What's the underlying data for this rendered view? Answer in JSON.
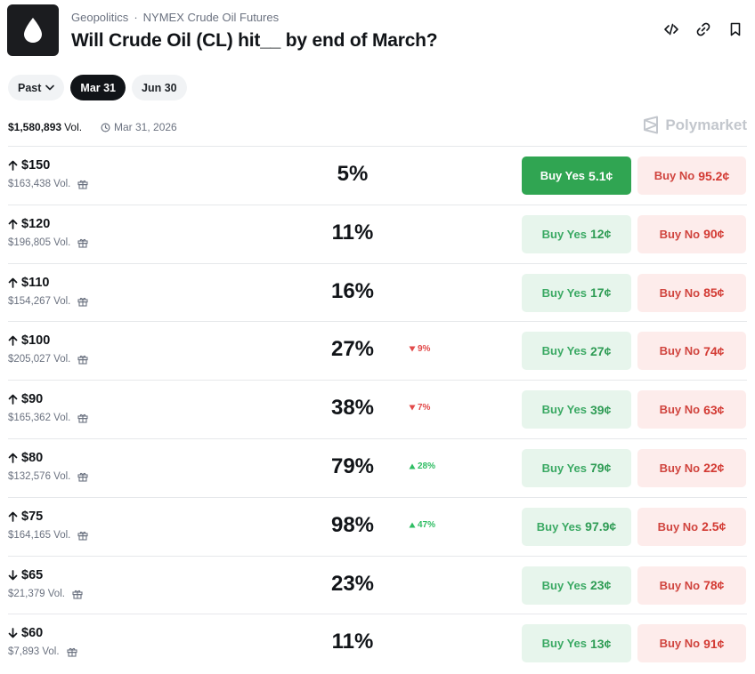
{
  "header": {
    "category": "Geopolitics",
    "separator": "·",
    "subcategory": "NYMEX Crude Oil Futures",
    "title": "Will Crude Oil (CL) hit__ by end of March?",
    "icons": [
      "embed-code-icon",
      "link-icon",
      "bookmark-icon"
    ]
  },
  "date_tabs": [
    {
      "label": "Past",
      "has_dropdown": true,
      "active": false
    },
    {
      "label": "Mar 31",
      "active": true
    },
    {
      "label": "Jun 30",
      "active": false
    }
  ],
  "meta": {
    "volume": "$1,580,893",
    "volume_label": "Vol.",
    "end_date": "Mar 31, 2026",
    "brand": "Polymarket"
  },
  "colors": {
    "yes_strong": "#30a552",
    "yes_soft": "#e7f5ec",
    "no_soft": "#fdeceb",
    "down": "#e24a4a",
    "up": "#2fbd63"
  },
  "markets": [
    {
      "direction": "up",
      "strike": "$150",
      "volume": "$163,438 Vol.",
      "percent": "5%",
      "change": null,
      "yes_label": "Buy Yes",
      "yes_price": "5.1¢",
      "no_label": "Buy No",
      "no_price": "95.2¢",
      "yes_highlight": true
    },
    {
      "direction": "up",
      "strike": "$120",
      "volume": "$196,805 Vol.",
      "percent": "11%",
      "change": null,
      "yes_label": "Buy Yes",
      "yes_price": "12¢",
      "no_label": "Buy No",
      "no_price": "90¢"
    },
    {
      "direction": "up",
      "strike": "$110",
      "volume": "$154,267 Vol.",
      "percent": "16%",
      "change": null,
      "yes_label": "Buy Yes",
      "yes_price": "17¢",
      "no_label": "Buy No",
      "no_price": "85¢"
    },
    {
      "direction": "up",
      "strike": "$100",
      "volume": "$205,027 Vol.",
      "percent": "27%",
      "change": {
        "dir": "down",
        "value": "9%"
      },
      "yes_label": "Buy Yes",
      "yes_price": "27¢",
      "no_label": "Buy No",
      "no_price": "74¢"
    },
    {
      "direction": "up",
      "strike": "$90",
      "volume": "$165,362 Vol.",
      "percent": "38%",
      "change": {
        "dir": "down",
        "value": "7%"
      },
      "yes_label": "Buy Yes",
      "yes_price": "39¢",
      "no_label": "Buy No",
      "no_price": "63¢"
    },
    {
      "direction": "up",
      "strike": "$80",
      "volume": "$132,576 Vol.",
      "percent": "79%",
      "change": {
        "dir": "up",
        "value": "28%"
      },
      "yes_label": "Buy Yes",
      "yes_price": "79¢",
      "no_label": "Buy No",
      "no_price": "22¢"
    },
    {
      "direction": "up",
      "strike": "$75",
      "volume": "$164,165 Vol.",
      "percent": "98%",
      "change": {
        "dir": "up",
        "value": "47%"
      },
      "yes_label": "Buy Yes",
      "yes_price": "97.9¢",
      "no_label": "Buy No",
      "no_price": "2.5¢"
    },
    {
      "direction": "down",
      "strike": "$65",
      "volume": "$21,379 Vol.",
      "percent": "23%",
      "change": null,
      "yes_label": "Buy Yes",
      "yes_price": "23¢",
      "no_label": "Buy No",
      "no_price": "78¢"
    },
    {
      "direction": "down",
      "strike": "$60",
      "volume": "$7,893 Vol.",
      "percent": "11%",
      "change": null,
      "yes_label": "Buy Yes",
      "yes_price": "13¢",
      "no_label": "Buy No",
      "no_price": "91¢"
    }
  ]
}
